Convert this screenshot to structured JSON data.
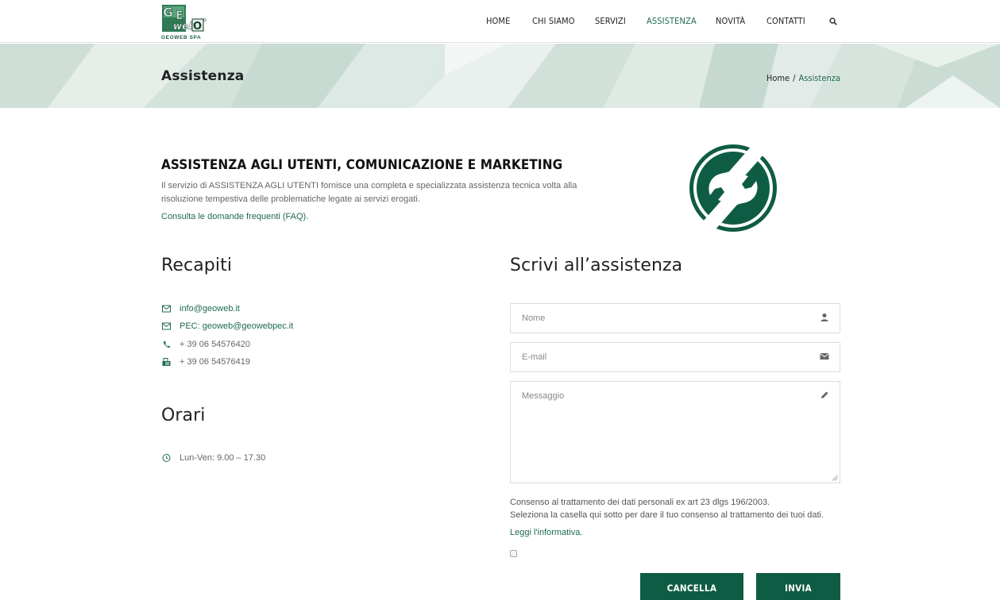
{
  "header": {
    "logo_text": "GEOWEB SPA",
    "nav": [
      {
        "label": "HOME",
        "active": false
      },
      {
        "label": "CHI SIAMO",
        "active": false
      },
      {
        "label": "SERVIZI",
        "active": false
      },
      {
        "label": "ASSISTENZA",
        "active": true
      },
      {
        "label": "NOVITÀ",
        "active": false
      },
      {
        "label": "CONTATTI",
        "active": false
      }
    ],
    "search_icon": "search-icon"
  },
  "banner": {
    "title": "Assistenza",
    "breadcrumb": {
      "home": "Home",
      "separator": "/",
      "current": "Assistenza"
    }
  },
  "intro": {
    "title": "ASSISTENZA AGLI UTENTI, COMUNICAZIONE E MARKETING",
    "description": "Il servizio di ASSISTENZA AGLI UTENTI fornisce una completa e specializzata assistenza tecnica volta alla risoluzione tempestiva delle problematiche legate ai servizi erogati.",
    "faq_link": "Consulta le domande frequenti (FAQ)."
  },
  "recapiti": {
    "title": "Recapiti",
    "items": [
      {
        "icon": "envelope-icon",
        "text": "info@geoweb.it",
        "link": true
      },
      {
        "icon": "envelope-icon",
        "text": "PEC: geoweb@geowebpec.it",
        "link": true
      },
      {
        "icon": "phone-icon",
        "text": "+ 39 06 54576420",
        "link": false
      },
      {
        "icon": "fax-icon",
        "text": "+ 39 06 54576419",
        "link": false
      }
    ]
  },
  "orari": {
    "title": "Orari",
    "items": [
      {
        "icon": "clock-icon",
        "text": "Lun-Ven: 9.00 – 17.30"
      }
    ]
  },
  "form": {
    "title": "Scrivi all’assistenza",
    "name_placeholder": "Nome",
    "email_placeholder": "E-mail",
    "message_placeholder": "Messaggio",
    "consent_line1": "Consenso al trattamento dei dati personali ex art 23 dlgs 196/2003.",
    "consent_line2": "Seleziona la casella qui sotto per dare il tuo consenso al trattamento dei tuoi dati.",
    "consent_link": "Leggi l'informativa.",
    "cancel_label": "CANCELLA",
    "submit_label": "INVIA"
  },
  "colors": {
    "brand_green": "#0f5c44",
    "link_green": "#1d6b50"
  }
}
